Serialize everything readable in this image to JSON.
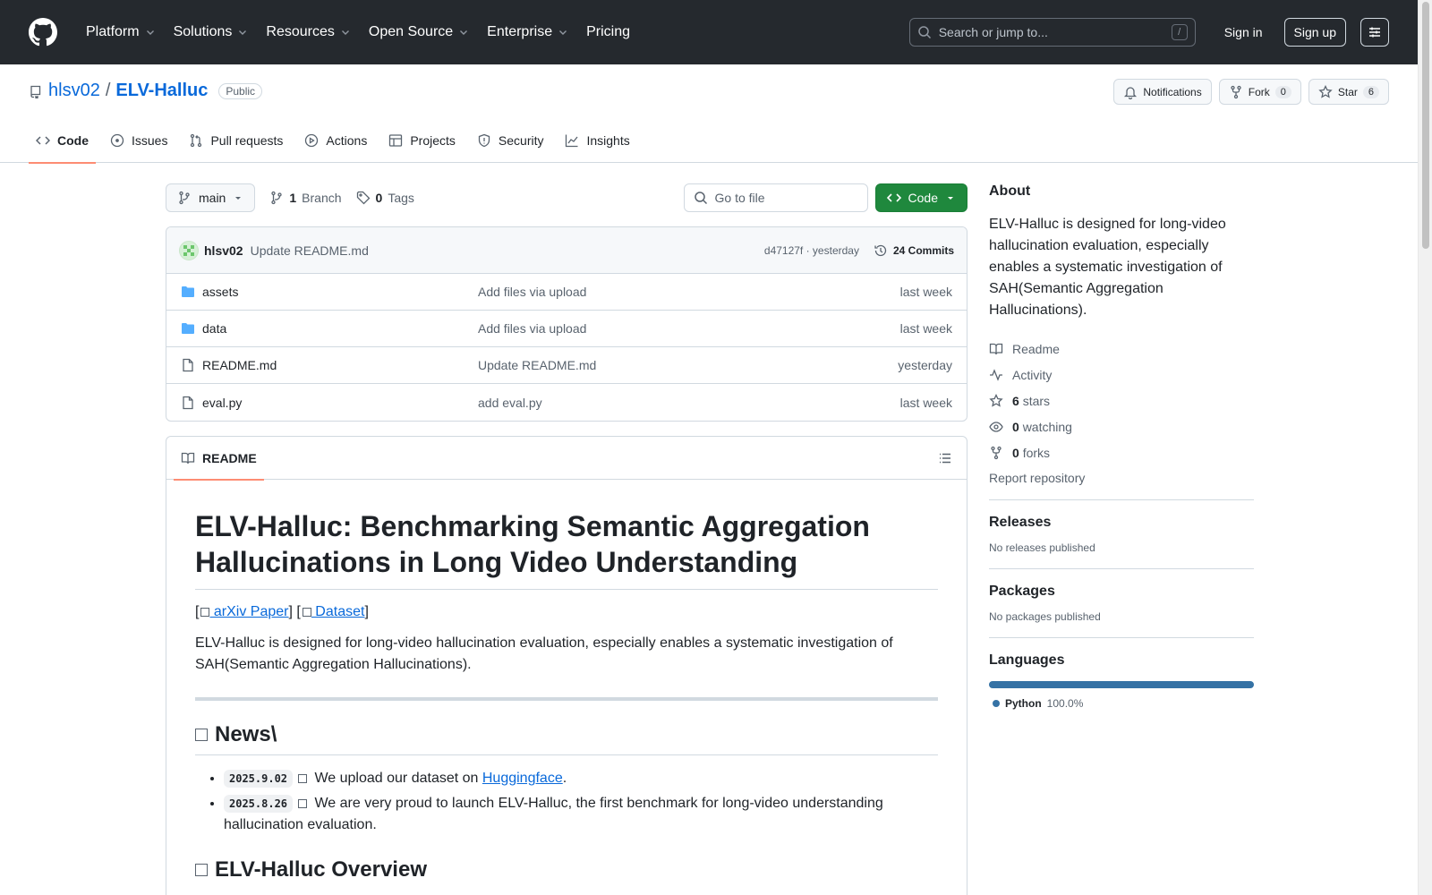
{
  "header": {
    "nav": [
      {
        "label": "Platform"
      },
      {
        "label": "Solutions"
      },
      {
        "label": "Resources"
      },
      {
        "label": "Open Source"
      },
      {
        "label": "Enterprise"
      },
      {
        "label": "Pricing"
      }
    ],
    "search_placeholder": "Search or jump to...",
    "search_shortcut": "/",
    "signin": "Sign in",
    "signup": "Sign up"
  },
  "repo": {
    "owner": "hlsv02",
    "sep": "/",
    "name": "ELV-Halluc",
    "visibility": "Public",
    "notifications": "Notifications",
    "fork_label": "Fork",
    "fork_count": "0",
    "star_label": "Star",
    "star_count": "6",
    "tabs": [
      {
        "label": "Code"
      },
      {
        "label": "Issues"
      },
      {
        "label": "Pull requests"
      },
      {
        "label": "Actions"
      },
      {
        "label": "Projects"
      },
      {
        "label": "Security"
      },
      {
        "label": "Insights"
      }
    ]
  },
  "toolbar": {
    "branch": "main",
    "branch_count": "1",
    "branch_label": "Branch",
    "tag_count": "0",
    "tag_label": "Tags",
    "goto_placeholder": "Go to file",
    "code_label": "Code"
  },
  "commit": {
    "author": "hlsv02",
    "message": "Update README.md",
    "hash_time": "d47127f · yesterday",
    "commits": "24 Commits"
  },
  "files": [
    {
      "name": "assets",
      "message": "Add files via upload",
      "time": "last week"
    },
    {
      "name": "data",
      "message": "Add files via upload",
      "time": "last week"
    },
    {
      "name": "README.md",
      "message": "Update README.md",
      "time": "yesterday"
    },
    {
      "name": "eval.py",
      "message": "add eval.py",
      "time": "last week"
    }
  ],
  "readme": {
    "tab": "README",
    "title": "ELV-Halluc: Benchmarking Semantic Aggregation Hallucinations in Long Video Understanding",
    "link_open1": "[",
    "link1": " arXiv Paper",
    "link_mid": "] [",
    "link2": " Dataset",
    "link_close": "]",
    "intro": "ELV-Halluc is designed for long-video hallucination evaluation, especially enables a systematic investigation of SAH(Semantic Aggregation Hallucinations).",
    "news_heading": "News\\",
    "news": [
      {
        "date": "2025.9.02",
        "text_before": " We upload our dataset on ",
        "link": "Huggingface",
        "text_after": "."
      },
      {
        "date": "2025.8.26",
        "text_before": " We are very proud to launch ELV-Halluc, the first benchmark for long-video understanding hallucination evaluation.",
        "link": "",
        "text_after": ""
      }
    ],
    "overview_heading": "ELV-Halluc Overview"
  },
  "sidebar": {
    "about_heading": "About",
    "description": "ELV-Halluc is designed for long-video hallucination evaluation, especially enables a systematic investigation of SAH(Semantic Aggregation Hallucinations).",
    "readme": "Readme",
    "activity": "Activity",
    "stars_count": "6",
    "stars_label": "stars",
    "watching_count": "0",
    "watching_label": "watching",
    "forks_count": "0",
    "forks_label": "forks",
    "report": "Report repository",
    "releases_heading": "Releases",
    "releases_text": "No releases published",
    "packages_heading": "Packages",
    "packages_text": "No packages published",
    "languages_heading": "Languages",
    "language_name": "Python",
    "language_pct": "100.0%",
    "language_color": "#3572A5"
  }
}
